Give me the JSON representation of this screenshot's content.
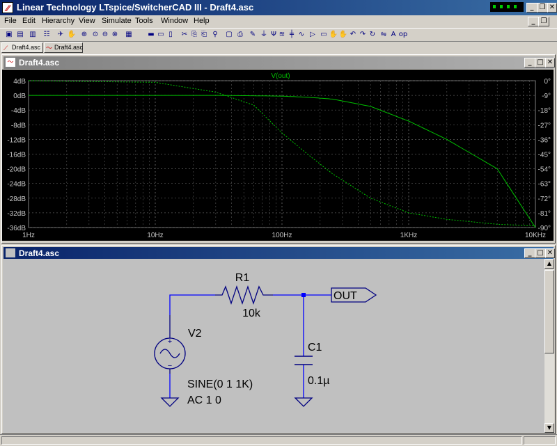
{
  "window": {
    "title": "Linear Technology LTspice/SwitcherCAD III - Draft4.asc"
  },
  "menu": [
    "File",
    "Edit",
    "Hierarchy",
    "View",
    "Simulate",
    "Tools",
    "Window",
    "Help"
  ],
  "toolbar_icons": [
    "new-schematic-icon",
    "open-icon",
    "save-icon",
    "control-panel-icon",
    "run-icon",
    "halt-icon",
    "zoom-in-icon",
    "pan-icon",
    "zoom-out-icon",
    "zoom-fit-icon",
    "autorange-icon",
    "tile-horizontal-icon",
    "tile-vertical-icon",
    "cascade-icon",
    "cut-icon",
    "copy-icon",
    "paste-icon",
    "find-icon",
    "print-setup-icon",
    "print-icon",
    "wire-icon",
    "ground-icon",
    "label-icon",
    "resistor-icon",
    "capacitor-icon",
    "inductor-icon",
    "diode-icon",
    "component-icon",
    "move-icon",
    "drag-icon",
    "undo-icon",
    "redo-icon",
    "rotate-icon",
    "mirror-icon",
    "text-icon",
    "spice-directive-icon"
  ],
  "tabs": [
    {
      "label": "Draft4.asc",
      "icon": "schematic-icon"
    },
    {
      "label": "Draft4.asc",
      "icon": "waveform-icon"
    }
  ],
  "plot_window": {
    "title": "Draft4.asc"
  },
  "schematic_window": {
    "title": "Draft4.asc"
  },
  "chart_data": {
    "type": "line",
    "title": "V(out)",
    "xlabel": "",
    "ylabel": "",
    "x_scale": "log",
    "xlim": [
      1,
      10000
    ],
    "x_ticks": [
      {
        "v": 1,
        "label": "1Hz"
      },
      {
        "v": 10,
        "label": "10Hz"
      },
      {
        "v": 100,
        "label": "100Hz"
      },
      {
        "v": 1000,
        "label": "1KHz"
      },
      {
        "v": 10000,
        "label": "10KHz"
      }
    ],
    "ylim": [
      -36,
      4
    ],
    "y_ticks": [
      "4dB",
      "0dB",
      "-4dB",
      "-8dB",
      "-12dB",
      "-16dB",
      "-20dB",
      "-24dB",
      "-28dB",
      "-32dB",
      "-36dB"
    ],
    "y2lim": [
      -90,
      0
    ],
    "y2_ticks": [
      "0°",
      "-9°",
      "-18°",
      "-27°",
      "-36°",
      "-45°",
      "-54°",
      "-63°",
      "-72°",
      "-81°",
      "-90°"
    ],
    "grid": true,
    "colors": {
      "trace": "#00c000",
      "grid": "#5a5a5a",
      "axis_text": "#c8c8c8",
      "background": "#000000"
    },
    "series": [
      {
        "name": "V(out)",
        "style": "solid",
        "axis": "left",
        "x": [
          1,
          10,
          30,
          60,
          100,
          159,
          250,
          500,
          1000,
          2000,
          5000,
          10000
        ],
        "y": [
          0,
          0,
          0,
          -0.1,
          -0.2,
          -0.5,
          -1.0,
          -3.0,
          -7.0,
          -12.0,
          -20.0,
          -36.0
        ]
      },
      {
        "name": "V(out)",
        "style": "dashed",
        "axis": "right",
        "x": [
          1,
          10,
          30,
          60,
          100,
          159,
          250,
          500,
          1000,
          2000,
          5000,
          10000
        ],
        "y": [
          0,
          -1,
          -7,
          -15,
          -32,
          -45,
          -57,
          -72,
          -81,
          -85,
          -88,
          -89
        ]
      }
    ]
  },
  "schematic": {
    "components": {
      "R1": {
        "name": "R1",
        "value": "10k"
      },
      "C1": {
        "name": "C1",
        "value": "0.1µ"
      },
      "V2": {
        "name": "V2",
        "value1": "SINE(0 1 1K)",
        "value2": "AC 1 0"
      }
    },
    "labels": {
      "out": "OUT"
    },
    "colors": {
      "wire": "#0000ff",
      "component": "#000080",
      "text": "#000000",
      "junction": "#0000ff"
    }
  }
}
